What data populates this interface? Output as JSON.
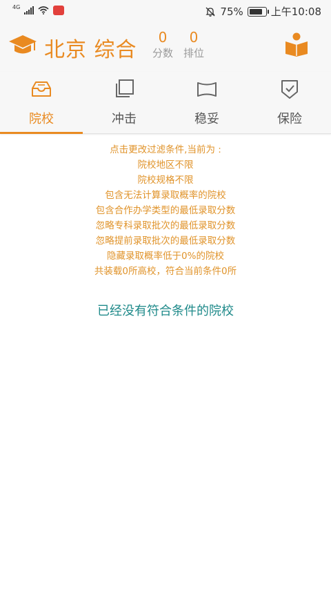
{
  "status_bar": {
    "network": "4G",
    "battery": "75%",
    "time": "上午10:08"
  },
  "header": {
    "region": "北京 综合",
    "score_value": "0",
    "score_label": "分数",
    "rank_value": "0",
    "rank_label": "排位"
  },
  "tabs": [
    {
      "label": "院校",
      "icon": "inbox-icon",
      "active": true
    },
    {
      "label": "冲击",
      "icon": "copy-icon",
      "active": false
    },
    {
      "label": "稳妥",
      "icon": "frame-icon",
      "active": false
    },
    {
      "label": "保险",
      "icon": "shield-check-icon",
      "active": false
    }
  ],
  "filters": {
    "intro": "点击更改过滤条件,当前为 :",
    "lines": [
      "院校地区不限",
      "院校规格不限",
      "包含无法计算录取概率的院校",
      "包含合作办学类型的最低录取分数",
      "忽略专科录取批次的最低录取分数",
      "忽略提前录取批次的最低录取分数",
      "隐藏录取概率低于0%的院校",
      "共装载0所高校，符合当前条件0所"
    ]
  },
  "empty_message": "已经没有符合条件的院校",
  "colors": {
    "accent": "#e98a21",
    "filter_text": "#e0932a",
    "empty_text": "#1f8a8a",
    "header_bg": "#f7f7f7"
  }
}
